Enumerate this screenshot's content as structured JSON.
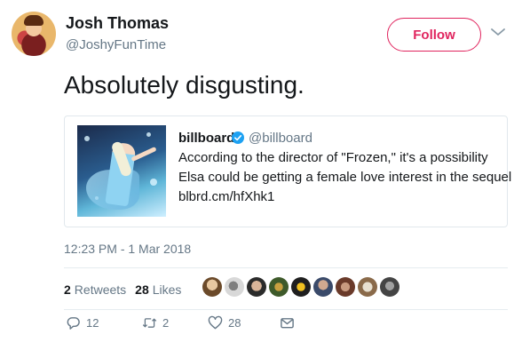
{
  "author": {
    "name": "Josh Thomas",
    "handle": "@JoshyFunTime"
  },
  "follow_button": {
    "label": "Follow"
  },
  "tweet": {
    "text": "Absolutely disgusting.",
    "timestamp": "12:23 PM - 1 Mar 2018"
  },
  "quoted": {
    "name": "billboard",
    "handle": "@billboard",
    "line1": "According to the director of \"Frozen,\" it's a possibility",
    "line2": "Elsa could be getting a female love interest in the sequel",
    "line3": "blbrd.cm/hfXhk1"
  },
  "stats": {
    "retweets_count": "2",
    "retweets_label": "Retweets",
    "likes_count": "28",
    "likes_label": "Likes"
  },
  "liker_avatars": [
    "avatar-1",
    "avatar-2",
    "avatar-3",
    "avatar-4",
    "avatar-5",
    "avatar-6",
    "avatar-7",
    "avatar-8",
    "avatar-9"
  ],
  "actions": {
    "reply_count": "12",
    "retweet_count": "2",
    "like_count": "28"
  },
  "colors": {
    "follow_accent": "#e0245e",
    "secondary_text": "#657786",
    "verified_blue": "#1da1f2"
  },
  "icons": [
    "chevron-down-icon",
    "verified-icon",
    "reply-icon",
    "retweet-icon",
    "heart-icon",
    "direct-message-icon"
  ]
}
